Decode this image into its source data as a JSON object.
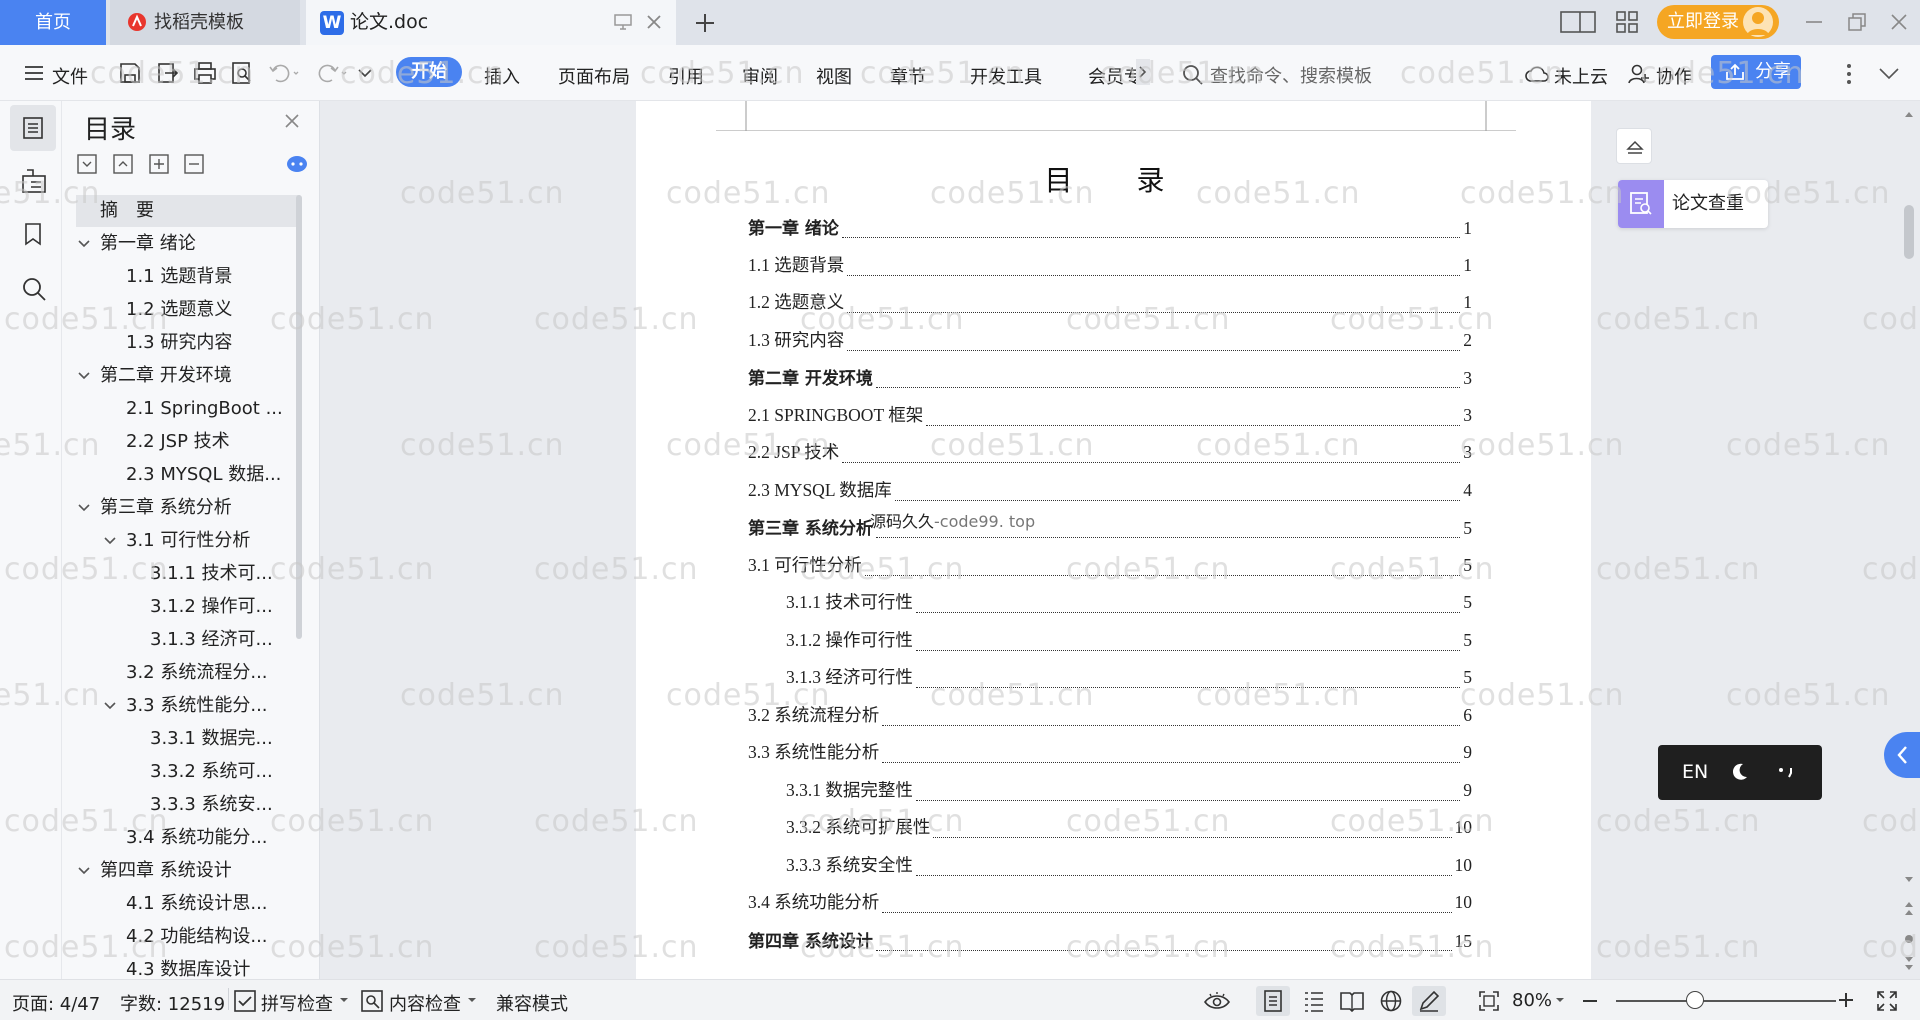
{
  "tabs": {
    "home": "首页",
    "template": "找稻壳模板",
    "document": "论文.doc",
    "login": "立即登录"
  },
  "toolbar": {
    "file": "文件",
    "menus": [
      "开始",
      "插入",
      "页面布局",
      "引用",
      "审阅",
      "视图",
      "章节",
      "开发工具",
      "会员专"
    ],
    "search_placeholder": "查找命令、搜索模板",
    "cloud": "未上云",
    "collab": "协作",
    "share": "分享"
  },
  "toc_panel": {
    "title": "目录",
    "items": [
      {
        "label": "摘　要",
        "level": 0,
        "selected": true,
        "expander": "none"
      },
      {
        "label": "第一章  绪论",
        "level": 0,
        "expander": "open"
      },
      {
        "label": "1.1  选题背景",
        "level": 1,
        "expander": "none"
      },
      {
        "label": "1.2  选题意义",
        "level": 1,
        "expander": "none"
      },
      {
        "label": "1.3  研究内容",
        "level": 1,
        "expander": "none"
      },
      {
        "label": "第二章  开发环境",
        "level": 0,
        "expander": "open"
      },
      {
        "label": "2.1 SpringBoot ...",
        "level": 1,
        "expander": "none"
      },
      {
        "label": "2.2 JSP 技术",
        "level": 1,
        "expander": "none"
      },
      {
        "label": "2.3 MYSQL 数据...",
        "level": 1,
        "expander": "none"
      },
      {
        "label": "第三章  系统分析",
        "level": 0,
        "expander": "open"
      },
      {
        "label": "3.1 可行性分析",
        "level": 1,
        "expander": "open"
      },
      {
        "label": "3.1.1 技术可...",
        "level": 2,
        "expander": "none"
      },
      {
        "label": "3.1.2 操作可...",
        "level": 2,
        "expander": "none"
      },
      {
        "label": "3.1.3 经济可...",
        "level": 2,
        "expander": "none"
      },
      {
        "label": "3.2 系统流程分...",
        "level": 1,
        "expander": "none"
      },
      {
        "label": "3.3 系统性能分...",
        "level": 1,
        "expander": "open"
      },
      {
        "label": "3.3.1 数据完...",
        "level": 2,
        "expander": "none"
      },
      {
        "label": "3.3.2 系统可...",
        "level": 2,
        "expander": "none"
      },
      {
        "label": "3.3.3 系统安...",
        "level": 2,
        "expander": "none"
      },
      {
        "label": "3.4 系统功能分...",
        "level": 1,
        "expander": "none"
      },
      {
        "label": "第四章  系统设计",
        "level": 0,
        "expander": "open"
      },
      {
        "label": "4.1  系统设计思...",
        "level": 1,
        "expander": "none"
      },
      {
        "label": "4.2 功能结构设...",
        "level": 1,
        "expander": "none"
      },
      {
        "label": "4.3 数据库设计",
        "level": 1,
        "expander": "none"
      }
    ]
  },
  "document": {
    "heading": "目　录",
    "entries": [
      {
        "text": "第一章  绪论",
        "page": "1",
        "bold": true,
        "indent": 0
      },
      {
        "text": "1.1  选题背景",
        "page": "1",
        "bold": false,
        "indent": 0
      },
      {
        "text": "1.2  选题意义",
        "page": "1",
        "bold": false,
        "indent": 0
      },
      {
        "text": "1.3  研究内容",
        "page": "2",
        "bold": false,
        "indent": 0
      },
      {
        "text": "第二章  开发环境",
        "page": "3",
        "bold": true,
        "indent": 0
      },
      {
        "text": "2.1 SPRINGBOOT 框架",
        "page": "3",
        "bold": false,
        "indent": 0
      },
      {
        "text": "2.2 JSP 技术",
        "page": "3",
        "bold": false,
        "indent": 0
      },
      {
        "text": "2.3 MYSQL 数据库",
        "page": "4",
        "bold": false,
        "indent": 0
      },
      {
        "text": "第三章  系统分析",
        "page": "5",
        "bold": true,
        "indent": 0
      },
      {
        "text": "3.1 可行性分析",
        "page": "5",
        "bold": false,
        "indent": 0
      },
      {
        "text": "3.1.1 技术可行性",
        "page": "5",
        "bold": false,
        "indent": 1
      },
      {
        "text": "3.1.2 操作可行性",
        "page": "5",
        "bold": false,
        "indent": 1
      },
      {
        "text": "3.1.3 经济可行性",
        "page": "5",
        "bold": false,
        "indent": 1
      },
      {
        "text": "3.2 系统流程分析",
        "page": "6",
        "bold": false,
        "indent": 0
      },
      {
        "text": "3.3 系统性能分析",
        "page": "9",
        "bold": false,
        "indent": 0
      },
      {
        "text": "3.3.1 数据完整性",
        "page": "9",
        "bold": false,
        "indent": 1
      },
      {
        "text": "3.3.2 系统可扩展性",
        "page": "10",
        "bold": false,
        "indent": 1
      },
      {
        "text": "3.3.3 系统安全性",
        "page": "10",
        "bold": false,
        "indent": 1
      },
      {
        "text": "3.4 系统功能分析",
        "page": "10",
        "bold": false,
        "indent": 0
      },
      {
        "text": "第四章  系统设计",
        "page": "15",
        "bold": true,
        "indent": 0
      }
    ],
    "overlay_text": "源码久久",
    "overlay_text_gray": "-code99. top"
  },
  "side_panel": {
    "check_label": "论文查重",
    "ime_label": "EN"
  },
  "statusbar": {
    "page": "页面: 4/47",
    "words": "字数: 12519",
    "spell": "拼写检查",
    "content": "内容检查",
    "mode": "兼容模式",
    "zoom": "80%"
  },
  "watermark": "code51.cn",
  "colors": {
    "accent": "#4a83f1",
    "login": "#f5a623",
    "check_icon": "#9b8cf0"
  }
}
